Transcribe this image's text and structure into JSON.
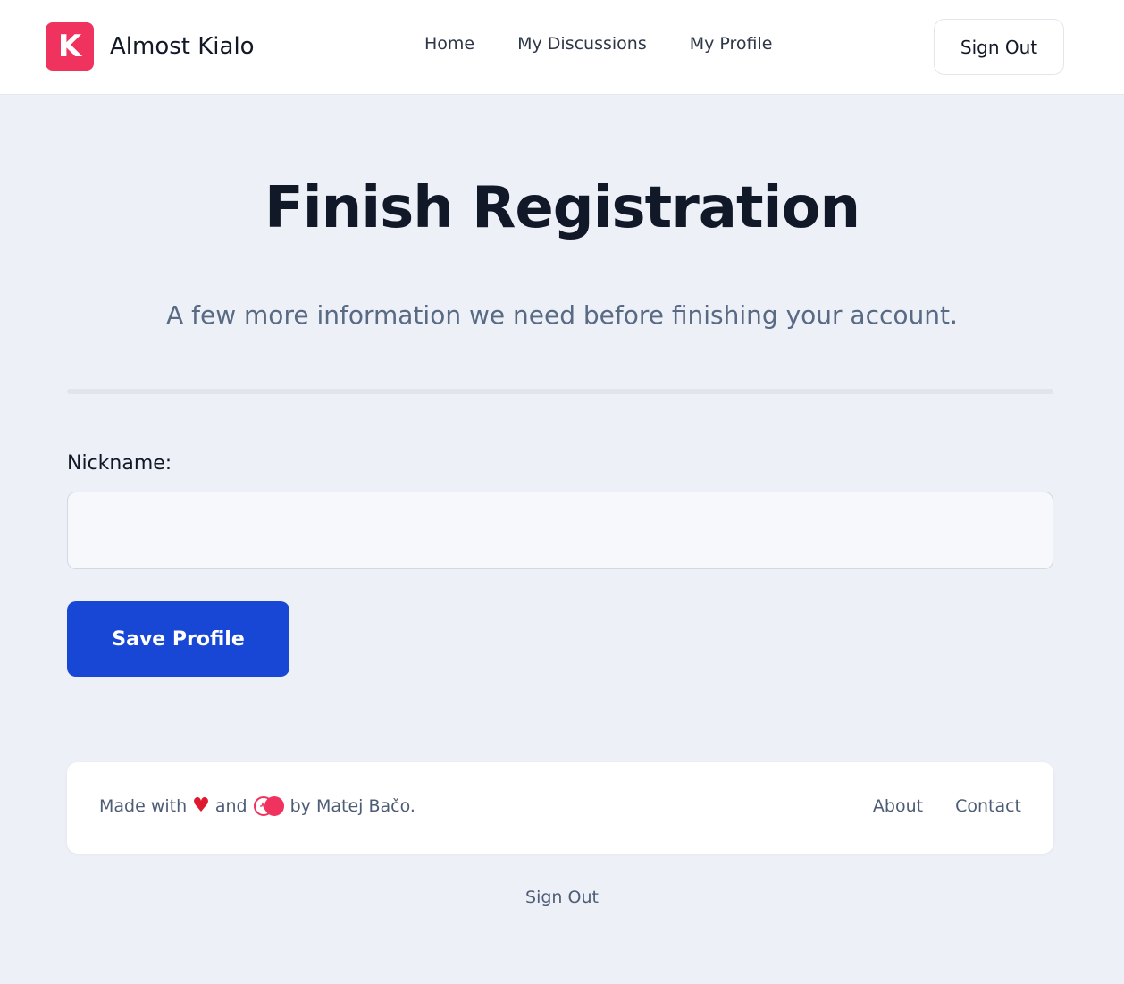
{
  "header": {
    "logo_letter": "K",
    "brand_name": "Almost Kialo",
    "nav": [
      {
        "label": "Home"
      },
      {
        "label": "My Discussions"
      },
      {
        "label": "My Profile"
      }
    ],
    "sign_out_label": "Sign Out"
  },
  "main": {
    "title": "Finish Registration",
    "subtitle": "A few more information we need before finishing your account.",
    "nickname_label": "Nickname:",
    "nickname_value": "",
    "save_label": "Save Profile"
  },
  "footer": {
    "made_with": "Made with",
    "and": "and",
    "by": "by Matej Bačo.",
    "links": [
      {
        "label": "About"
      },
      {
        "label": "Contact"
      }
    ],
    "sign_out_label": "Sign Out"
  },
  "colors": {
    "brand": "#f0325e",
    "primary": "#1847d6",
    "background": "#edf1f7"
  },
  "icons": [
    "logo-icon",
    "heart-icon",
    "toggle-icon"
  ]
}
